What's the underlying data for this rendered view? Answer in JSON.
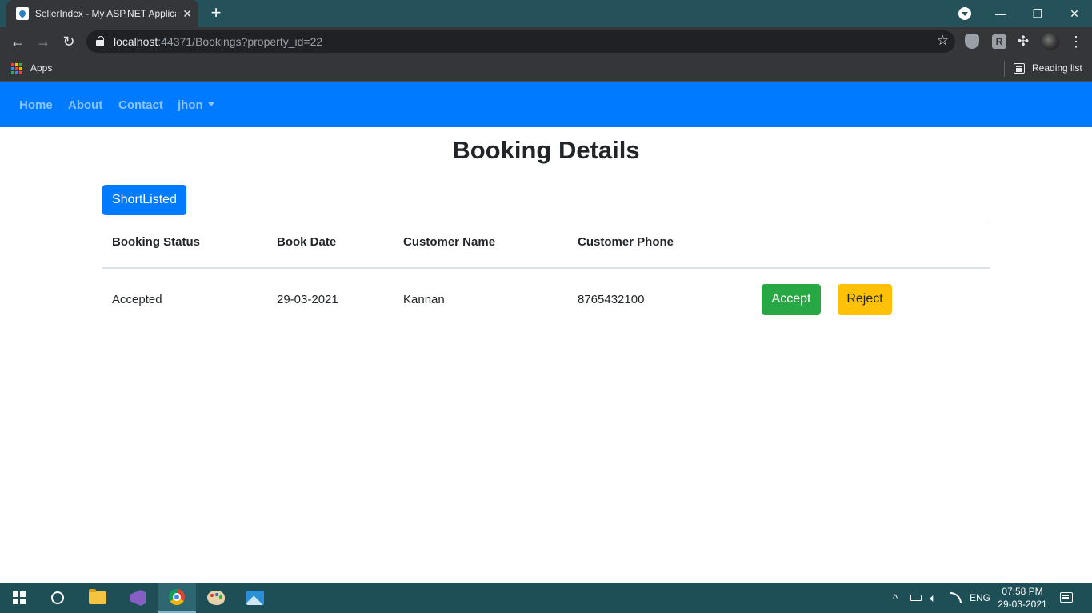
{
  "browser": {
    "tab_title": "SellerIndex - My ASP.NET Applica",
    "tab_close": "✕",
    "new_tab": "+",
    "url_host": "localhost",
    "url_rest": ":44371/Bookings?property_id=22",
    "bookmarks_apps": "Apps",
    "reading_list": "Reading list",
    "window_controls": {
      "minimize": "—",
      "restore": "❐",
      "close": "✕"
    },
    "nav": {
      "back": "←",
      "forward": "→",
      "reload": "↻",
      "star": "☆",
      "menu": "⋮",
      "extensions": "✣",
      "ext_r": "R"
    }
  },
  "site_nav": {
    "home": "Home",
    "about": "About",
    "contact": "Contact",
    "user": "jhon"
  },
  "page": {
    "title": "Booking Details",
    "shortlisted_button": "ShortListed",
    "table": {
      "headers": [
        "Booking Status",
        "Book Date",
        "Customer Name",
        "Customer Phone"
      ],
      "rows": [
        {
          "status": "Accepted",
          "date": "29-03-2021",
          "name": "Kannan",
          "phone": "8765432100",
          "accept": "Accept",
          "reject": "Reject"
        }
      ]
    }
  },
  "taskbar": {
    "time": "07:58 PM",
    "date": "29-03-2021",
    "language": "ENG",
    "tray_up": "^"
  },
  "colors": {
    "primary": "#007bff",
    "success": "#28a745",
    "warning": "#ffc107",
    "chrome_frame": "#25525a",
    "taskbar": "#1e4f57"
  }
}
